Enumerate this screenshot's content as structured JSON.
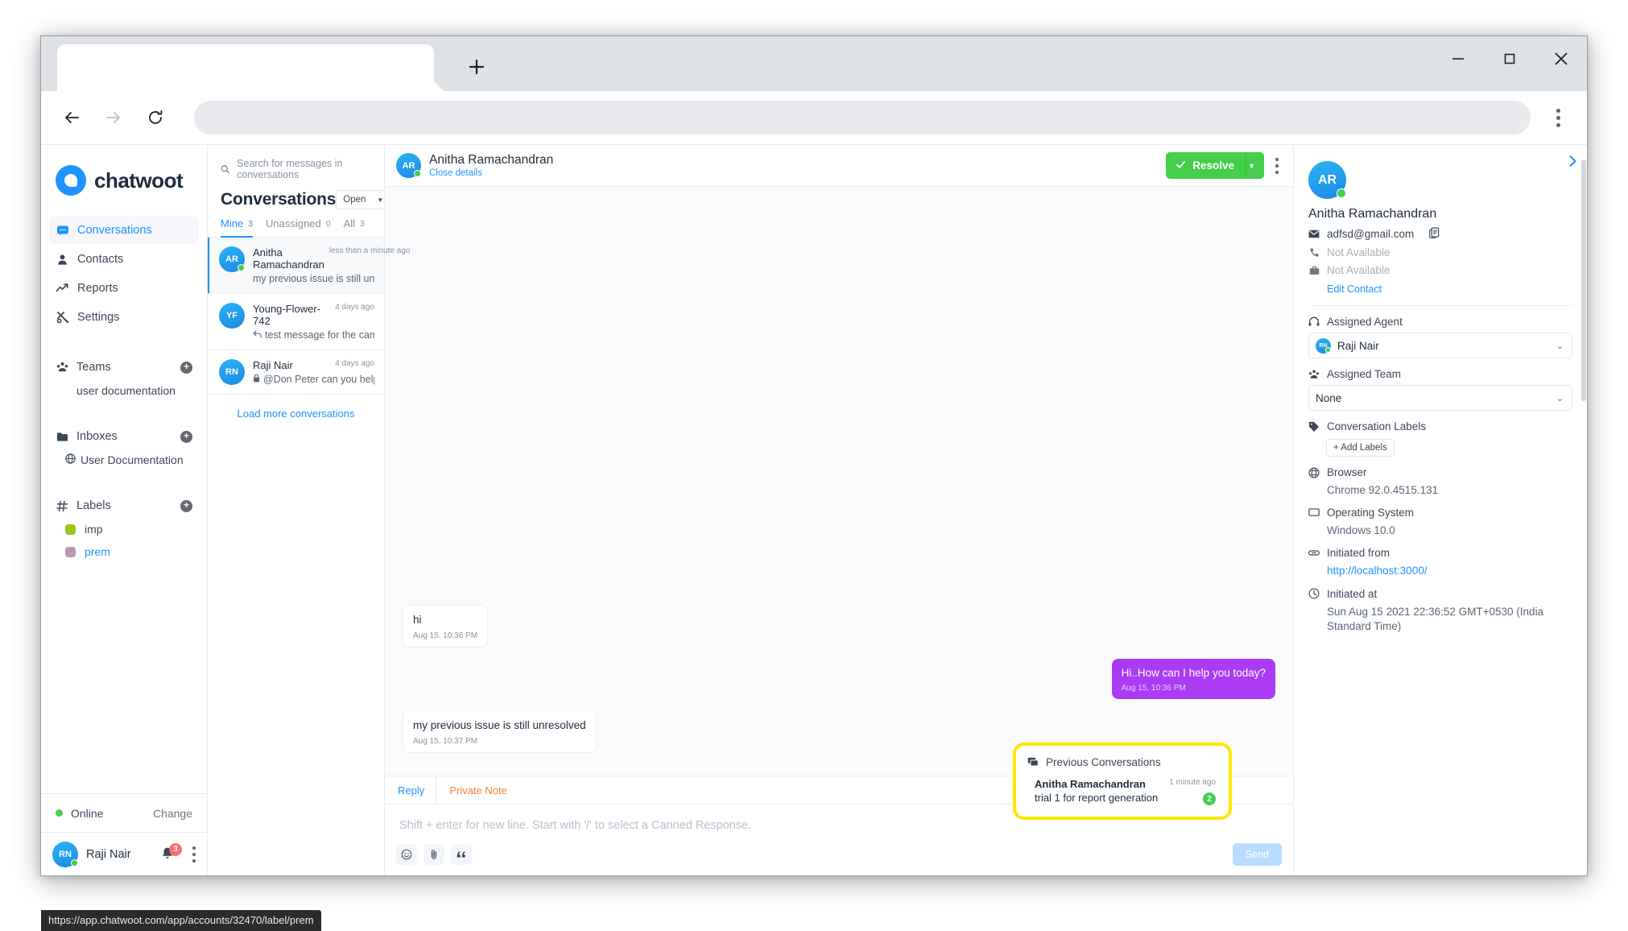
{
  "browser": {
    "tab_title": "",
    "new_tab_label": "+",
    "back_icon": "back-arrow-icon",
    "forward_icon": "forward-arrow-icon",
    "reload_icon": "reload-icon",
    "omnibox_value": "",
    "menu_icon": "kebab-menu-icon",
    "minimize_icon": "minimize-icon",
    "maximize_icon": "maximize-icon",
    "close_icon": "close-icon",
    "status_url": "https://app.chatwoot.com/app/accounts/32470/label/prem"
  },
  "sidebar": {
    "brand": "chatwoot",
    "nav": [
      {
        "label": "Conversations",
        "icon": "chat-bubble-icon",
        "active": true
      },
      {
        "label": "Contacts",
        "icon": "person-icon",
        "active": false
      },
      {
        "label": "Reports",
        "icon": "trend-line-icon",
        "active": false
      },
      {
        "label": "Settings",
        "icon": "tools-icon",
        "active": false
      }
    ],
    "teams": {
      "title": "Teams",
      "icon": "people-group-icon",
      "add_label": "+",
      "items": [
        "user documentation"
      ]
    },
    "inboxes": {
      "title": "Inboxes",
      "icon": "folder-icon",
      "add_label": "+",
      "items": [
        {
          "label": "User Documentation",
          "icon": "globe-icon"
        }
      ]
    },
    "labels": {
      "title": "Labels",
      "icon": "hash-icon",
      "add_label": "+",
      "items": [
        {
          "label": "imp",
          "color": "#9ac31c",
          "selected": false
        },
        {
          "label": "prem",
          "color": "#b79ab4",
          "selected": true
        }
      ]
    },
    "status": {
      "text": "Online",
      "change_label": "Change",
      "color": "#44ce4b"
    },
    "agent": {
      "initials": "RN",
      "name": "Raji Nair",
      "notification_count": "3"
    }
  },
  "conversation_list": {
    "search_placeholder": "Search for messages in conversations",
    "title": "Conversations",
    "status_filter": "Open",
    "tabs": [
      {
        "label": "Mine",
        "count": "3",
        "active": true
      },
      {
        "label": "Unassigned",
        "count": "0",
        "active": false
      },
      {
        "label": "All",
        "count": "3",
        "active": false
      }
    ],
    "items": [
      {
        "initials": "AR",
        "name": "Anitha Ramachandran",
        "preview": "my previous issue is still unresolved",
        "time": "less than a minute ago",
        "prefix_icon": "",
        "active": true,
        "online": true
      },
      {
        "initials": "YF",
        "name": "Young-Flower-742",
        "preview": "test message for the campaign",
        "time": "4 days ago",
        "prefix_icon": "reply-arrow-icon",
        "active": false,
        "online": false
      },
      {
        "initials": "RN",
        "name": "Raji Nair",
        "preview": "@Don Peter can you help me?",
        "time": "4 days ago",
        "prefix_icon": "lock-icon",
        "active": false,
        "online": false
      }
    ],
    "load_more": "Load more conversations"
  },
  "chat": {
    "header": {
      "initials": "AR",
      "name": "Anitha Ramachandran",
      "close_details": "Close details",
      "resolve_label": "Resolve",
      "resolve_color": "#44ce4b",
      "more_icon": "kebab-menu-icon"
    },
    "messages": [
      {
        "dir": "in",
        "text": "hi",
        "time": "Aug 15, 10:36 PM"
      },
      {
        "dir": "out",
        "text": "Hi..How can I help you today?",
        "time": "Aug 15, 10:36 PM"
      },
      {
        "dir": "in",
        "text": "my previous issue is still unresolved",
        "time": "Aug 15, 10:37 PM"
      }
    ],
    "reply": {
      "tabs": [
        {
          "label": "Reply",
          "active": true
        },
        {
          "label": "Private Note",
          "active": false
        }
      ],
      "placeholder": "Shift + enter for new line. Start with '/' to select a Canned Response.",
      "icons": [
        "emoji-icon",
        "attachment-icon",
        "canned-response-icon"
      ],
      "send_label": "Send"
    }
  },
  "contact_panel": {
    "toggle_icon": "chevron-right-icon",
    "initials": "AR",
    "name": "Anitha Ramachandran",
    "email": "adfsd@gmail.com",
    "copy_icon": "copy-icon",
    "phone": "Not Available",
    "company": "Not Available",
    "edit_contact": "Edit Contact",
    "assigned_agent": {
      "label": "Assigned Agent",
      "icon": "headset-icon",
      "initials": "RN",
      "value": "Raji Nair"
    },
    "assigned_team": {
      "label": "Assigned Team",
      "icon": "people-group-icon",
      "value": "None"
    },
    "conversation_labels": {
      "label": "Conversation Labels",
      "icon": "tag-icon",
      "add_label": "+ Add Labels"
    },
    "browser": {
      "label": "Browser",
      "icon": "browser-icon",
      "value": "Chrome 92.0.4515.131"
    },
    "os": {
      "label": "Operating System",
      "icon": "monitor-icon",
      "value": "Windows 10.0"
    },
    "initiated_from": {
      "label": "Initiated from",
      "icon": "link-icon",
      "value": "http://localhost:3000/"
    },
    "initiated_at": {
      "label": "Initiated at",
      "icon": "clock-icon",
      "value": "Sun Aug 15 2021 22:36:52 GMT+0530 (India Standard Time)"
    },
    "previous_conversations": {
      "label": "Previous Conversations",
      "icon": "conversations-icon",
      "highlight_color": "#ffe500",
      "items": [
        {
          "name": "Anitha Ramachandran",
          "preview": "trial 1 for report generation",
          "time": "1 minute ago",
          "badge": "2"
        }
      ]
    }
  }
}
